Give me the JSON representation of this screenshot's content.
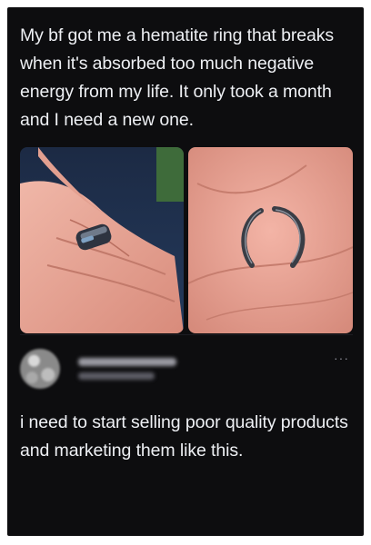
{
  "post": {
    "text": "My bf got me a hematite ring that breaks when it's absorbed too much negative energy from my life. It only took a month and I need a new one."
  },
  "images": [
    {
      "label": "hand-with-ring-photo"
    },
    {
      "label": "broken-ring-in-palm-photo"
    }
  ],
  "reply": {
    "author_name": "",
    "author_handle": "",
    "more_icon": "ellipsis-icon",
    "text": "i need to start selling poor quality products and marketing them like this."
  },
  "colors": {
    "background": "#0d0d0f",
    "text": "#eef0f4",
    "skin": "#e9a89a",
    "ring": "#3b3f4a"
  }
}
